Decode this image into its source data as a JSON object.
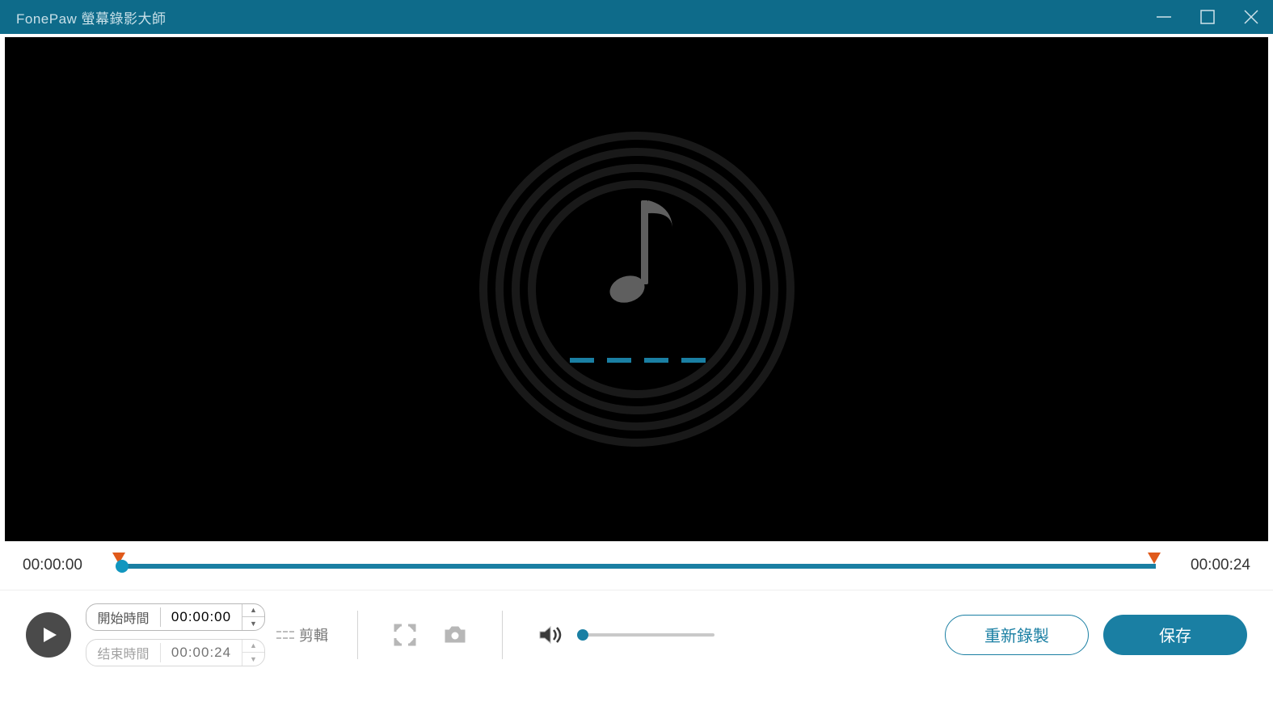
{
  "titlebar": {
    "title": "FonePaw 螢幕錄影大師"
  },
  "timeline": {
    "start": "00:00:00",
    "end": "00:00:24"
  },
  "fields": {
    "start_label": "開始時間",
    "start_value": "00:00:00",
    "end_label": "结束時間",
    "end_value": "00:00:24"
  },
  "clip": {
    "label": "剪輯"
  },
  "buttons": {
    "rerecord": "重新錄製",
    "save": "保存"
  }
}
